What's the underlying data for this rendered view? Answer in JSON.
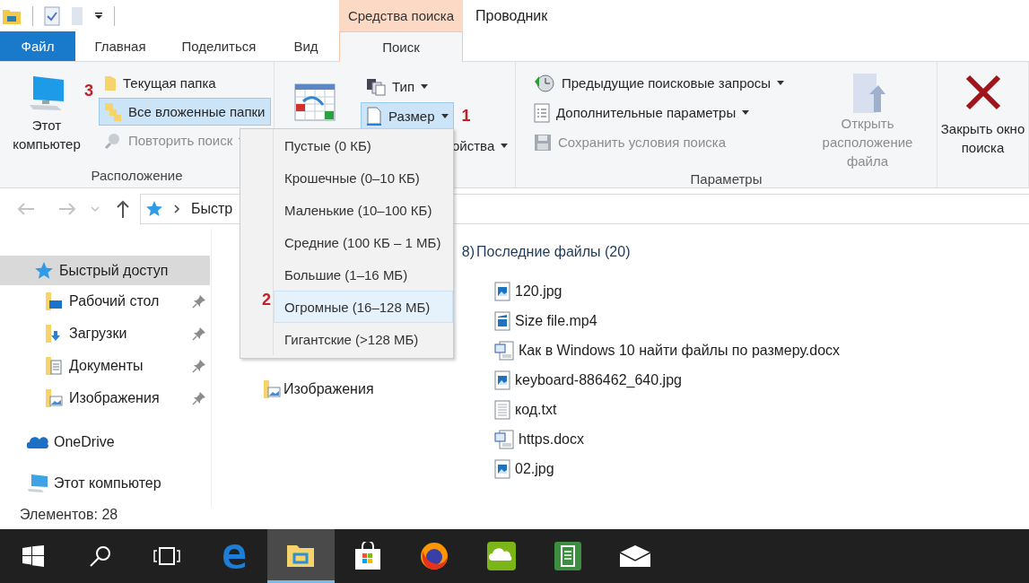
{
  "window": {
    "title": "Проводник",
    "context_group": "Средства поиска"
  },
  "tabs": [
    {
      "label": "Файл",
      "kind": "file",
      "selected": false
    },
    {
      "label": "Главная",
      "kind": "tab",
      "selected": false
    },
    {
      "label": "Поделиться",
      "kind": "tab",
      "selected": false
    },
    {
      "label": "Вид",
      "kind": "tab",
      "selected": false
    },
    {
      "label": "Поиск",
      "kind": "context",
      "selected": true
    }
  ],
  "ribbon": {
    "location": {
      "label": "Расположение",
      "this_pc": "Этот компьютер",
      "items": [
        {
          "label": "Текущая папка",
          "kind": "folder",
          "selected": false,
          "disabled": false
        },
        {
          "label": "Все вложенные папки",
          "kind": "subfolders",
          "selected": true,
          "disabled": false
        },
        {
          "label": "Повторить поиск",
          "kind": "repeat",
          "selected": false,
          "disabled": true
        }
      ]
    },
    "refine": {
      "type_button": "Тип",
      "size_button": "Размер",
      "size_open": true,
      "properties_fragment": "ойства"
    },
    "options": {
      "label": "Параметры",
      "items": [
        {
          "label": "Предыдущие поисковые запросы",
          "kind": "history",
          "disabled": false
        },
        {
          "label": "Дополнительные параметры",
          "kind": "params",
          "disabled": false
        },
        {
          "label": "Сохранить условия поиска",
          "kind": "save",
          "disabled": true
        }
      ],
      "open_location": {
        "label": "Открыть расположение файла",
        "disabled": true
      }
    },
    "close": {
      "label": "Закрыть окно поиска"
    }
  },
  "callouts": {
    "location": "3",
    "size": "1",
    "menu": "2"
  },
  "size_menu": [
    {
      "label": "Пустые (0 КБ)",
      "selected": false
    },
    {
      "label": "Крошечные (0–10 КБ)",
      "selected": false
    },
    {
      "label": "Маленькие (10–100 КБ)",
      "selected": false
    },
    {
      "label": "Средние (100 КБ – 1 МБ)",
      "selected": false
    },
    {
      "label": "Большие (1–16 МБ)",
      "selected": false
    },
    {
      "label": "Огромные (16–128 МБ)",
      "selected": true
    },
    {
      "label": "Гигантские (>128 МБ)",
      "selected": false
    }
  ],
  "address_bar": {
    "path": "Быстр"
  },
  "sidebar": {
    "items": [
      {
        "label": "Быстрый доступ",
        "kind": "star",
        "selected": true,
        "children": [
          {
            "label": "Рабочий стол",
            "kind": "desktop",
            "selected": false,
            "pinned": true
          },
          {
            "label": "Загрузки",
            "kind": "downloads",
            "selected": false,
            "pinned": true
          },
          {
            "label": "Документы",
            "kind": "documents",
            "selected": false,
            "pinned": true
          },
          {
            "label": "Изображения",
            "kind": "pictures",
            "selected": false,
            "pinned": true
          }
        ]
      },
      {
        "label": "OneDrive",
        "kind": "cloud",
        "selected": false
      },
      {
        "label": "Этот компьютер",
        "kind": "pc",
        "selected": false
      }
    ]
  },
  "content": {
    "folders_heading_fragment": "8)",
    "folders": [
      {
        "label": "Изображения"
      }
    ],
    "recent_heading": "Последние файлы (20)",
    "recent_files": [
      {
        "name": "120.jpg",
        "kind": "image"
      },
      {
        "name": "Size file.mp4",
        "kind": "video"
      },
      {
        "name": "Как в Windows 10 найти файлы по размеру.docx",
        "kind": "word"
      },
      {
        "name": "keyboard-886462_640.jpg",
        "kind": "image"
      },
      {
        "name": "код.txt",
        "kind": "text"
      },
      {
        "name": "https.docx",
        "kind": "word"
      },
      {
        "name": "02.jpg",
        "kind": "image"
      }
    ]
  },
  "status_bar": {
    "count": "Элементов: 28"
  },
  "taskbar": {
    "items": [
      {
        "kind": "start",
        "active": false
      },
      {
        "kind": "search",
        "active": false
      },
      {
        "kind": "taskview",
        "active": false
      },
      {
        "kind": "edge",
        "active": false
      },
      {
        "kind": "explorer",
        "active": true
      },
      {
        "kind": "store",
        "active": false
      },
      {
        "kind": "firefox",
        "active": false
      },
      {
        "kind": "cloudapp",
        "active": false
      },
      {
        "kind": "notes",
        "active": false
      },
      {
        "kind": "mail",
        "active": false
      }
    ]
  }
}
